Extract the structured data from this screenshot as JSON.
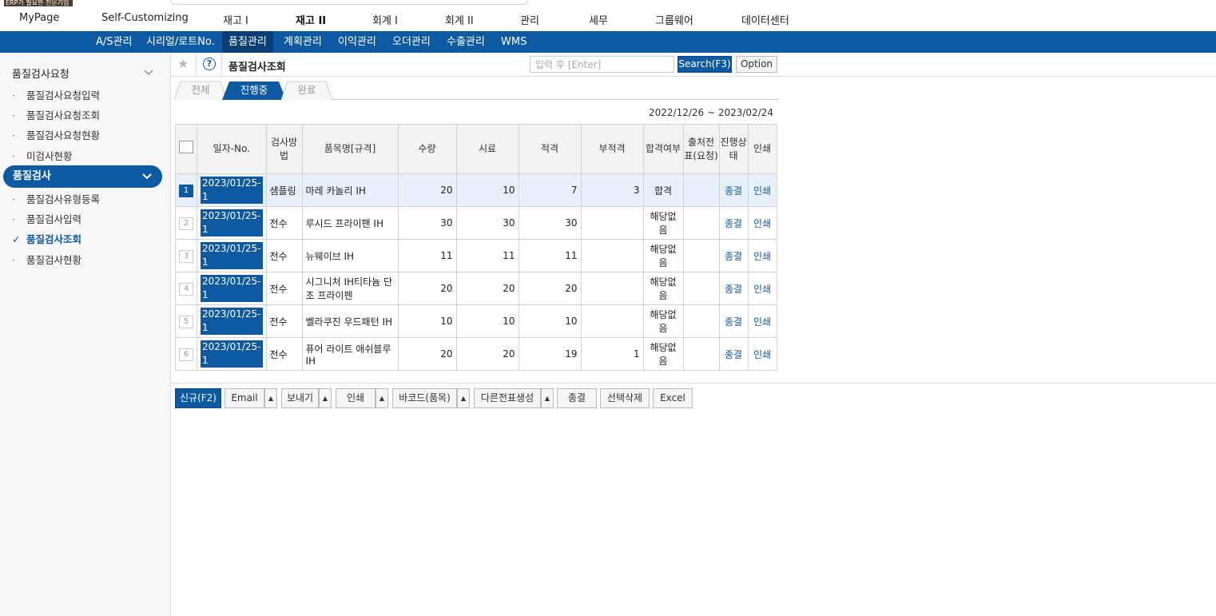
{
  "badge": "ERP가 필요한 전문기업",
  "top_menu": [
    {
      "label": "MyPage",
      "active": false
    },
    {
      "label": "Self-Customizing",
      "active": false
    },
    {
      "label": "재고 I",
      "active": false
    },
    {
      "label": "재고 II",
      "active": true
    },
    {
      "label": "회계 I",
      "active": false
    },
    {
      "label": "회계 II",
      "active": false
    },
    {
      "label": "관리",
      "active": false
    },
    {
      "label": "세무",
      "active": false
    },
    {
      "label": "그룹웨어",
      "active": false
    },
    {
      "label": "데이터센터",
      "active": false
    }
  ],
  "sub_menu": [
    {
      "label": "A/S관리",
      "active": false
    },
    {
      "label": "시리얼/로트No.",
      "active": false
    },
    {
      "label": "품질관리",
      "active": true
    },
    {
      "label": "계획관리",
      "active": false
    },
    {
      "label": "이익관리",
      "active": false
    },
    {
      "label": "오더관리",
      "active": false
    },
    {
      "label": "수출관리",
      "active": false
    },
    {
      "label": "WMS",
      "active": false
    }
  ],
  "sidebar": {
    "sections": [
      {
        "title": "품질검사요청",
        "items": [
          "품질검사요청입력",
          "품질검사요청조회",
          "품질검사요청현황",
          "미검사현황"
        ]
      },
      {
        "title": "품질검사",
        "items": [
          "품질검사유형등록",
          "품질검사입력",
          "품질검사조회",
          "품질검사현황"
        ],
        "active_item": "품질검사조회"
      }
    ]
  },
  "header": {
    "title": "품질검사조회",
    "search_placeholder": "입력 후 [Enter]",
    "search_button": "Search(F3)",
    "option_button": "Option",
    "help": "?"
  },
  "tabs": [
    {
      "label": "전체",
      "active": false
    },
    {
      "label": "진행중",
      "active": true
    },
    {
      "label": "완료",
      "active": false
    }
  ],
  "date_range": "2022/12/26 ~ 2023/02/24",
  "table": {
    "headers": {
      "date_no": "일자-No.",
      "method": "검사방법",
      "item": "품목명[규격]",
      "qty": "수량",
      "sample": "시료",
      "pass": "적격",
      "fail": "부적격",
      "result": "합격여부",
      "source": "출처전표(요청)",
      "status": "진행상태",
      "print": "인쇄"
    },
    "rows": [
      {
        "num": "1",
        "date_no": "2023/01/25-1",
        "method": "샘플링",
        "item": "마레 카놀리 IH",
        "qty": "20",
        "sample": "10",
        "pass": "7",
        "fail": "3",
        "result": "합격",
        "source": "",
        "status": "종결",
        "print": "인쇄",
        "selected": true
      },
      {
        "num": "2",
        "date_no": "2023/01/25-1",
        "method": "전수",
        "item": "루시드 프라이팬 IH",
        "qty": "30",
        "sample": "30",
        "pass": "30",
        "fail": "",
        "result": "해당없음",
        "source": "",
        "status": "종결",
        "print": "인쇄",
        "selected": false
      },
      {
        "num": "3",
        "date_no": "2023/01/25-1",
        "method": "전수",
        "item": "뉴웨이브 IH",
        "qty": "11",
        "sample": "11",
        "pass": "11",
        "fail": "",
        "result": "해당없음",
        "source": "",
        "status": "종결",
        "print": "인쇄",
        "selected": false
      },
      {
        "num": "4",
        "date_no": "2023/01/25-1",
        "method": "전수",
        "item": "시그니처 IH티타늄 단조 프라이펜",
        "qty": "20",
        "sample": "20",
        "pass": "20",
        "fail": "",
        "result": "해당없음",
        "source": "",
        "status": "종결",
        "print": "인쇄",
        "selected": false
      },
      {
        "num": "5",
        "date_no": "2023/01/25-1",
        "method": "전수",
        "item": "벨라쿠진 우드패턴 IH",
        "qty": "10",
        "sample": "10",
        "pass": "10",
        "fail": "",
        "result": "해당없음",
        "source": "",
        "status": "종결",
        "print": "인쇄",
        "selected": false
      },
      {
        "num": "6",
        "date_no": "2023/01/25-1",
        "method": "전수",
        "item": "퓨어 라이트 애쉬블루 IH",
        "qty": "20",
        "sample": "20",
        "pass": "19",
        "fail": "1",
        "result": "해당없음",
        "source": "",
        "status": "종결",
        "print": "인쇄",
        "selected": false
      }
    ]
  },
  "toolbar": {
    "new": "신규(F2)",
    "email": "Email",
    "send": "보내기",
    "print": "인쇄",
    "barcode": "바코드(품목)",
    "other_slip": "다른전표생성",
    "close": "종결",
    "delete_selected": "선택삭제",
    "excel": "Excel",
    "arrow": "▲"
  },
  "colors": {
    "brand": "#0d5aa2",
    "brand_dark": "#0a3e74",
    "selected_row": "#e8f1fb"
  }
}
